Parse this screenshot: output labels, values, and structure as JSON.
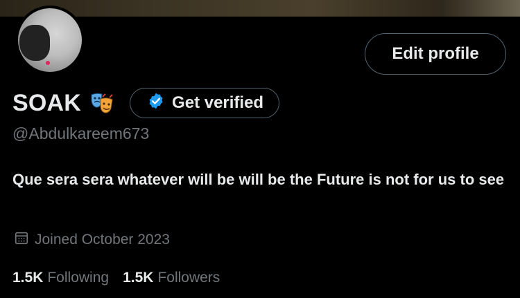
{
  "profile": {
    "display_name": "SOAK",
    "name_emoji": "performing-arts-masks",
    "handle": "@Abdulkareem673",
    "bio": "Que sera sera whatever will be will be the Future is not for us to see",
    "joined": "Joined October 2023",
    "following_count": "1.5K",
    "following_label": "Following",
    "followers_count": "1.5K",
    "followers_label": "Followers"
  },
  "buttons": {
    "edit_profile": "Edit profile",
    "get_verified": "Get verified"
  },
  "icons": {
    "verified": "verified-badge-icon",
    "calendar": "calendar-icon"
  },
  "colors": {
    "background": "#000000",
    "text_primary": "#e7e9ea",
    "text_secondary": "#71767b",
    "border": "#536471",
    "verified_blue": "#1d9bf0"
  }
}
